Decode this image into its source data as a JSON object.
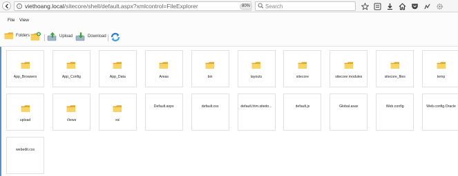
{
  "browser": {
    "url_host": "viethoang.local",
    "url_path": "/sitecore/shell/default.aspx?xmlcontrol=FileExplorer",
    "zoom": "80%",
    "search_placeholder": "Search"
  },
  "menu": {
    "file": "File",
    "view": "View"
  },
  "toolbar": {
    "folders": "Folders",
    "upload": "Upload",
    "download": "Download"
  },
  "items": [
    {
      "name": "App_Browsers",
      "type": "folder"
    },
    {
      "name": "App_Config",
      "type": "folder"
    },
    {
      "name": "App_Data",
      "type": "folder"
    },
    {
      "name": "Areas",
      "type": "folder"
    },
    {
      "name": "bin",
      "type": "folder"
    },
    {
      "name": "layouts",
      "type": "folder"
    },
    {
      "name": "sitecore",
      "type": "folder"
    },
    {
      "name": "sitecore modules",
      "type": "folder"
    },
    {
      "name": "sitecore_files",
      "type": "folder"
    },
    {
      "name": "temp",
      "type": "folder"
    },
    {
      "name": "upload",
      "type": "folder"
    },
    {
      "name": "Views",
      "type": "folder"
    },
    {
      "name": "xsl",
      "type": "folder"
    },
    {
      "name": "Default.aspx",
      "type": "file"
    },
    {
      "name": "default.css",
      "type": "file"
    },
    {
      "name": "default.htm.sitedo...",
      "type": "file"
    },
    {
      "name": "default.js",
      "type": "file"
    },
    {
      "name": "Global.asax",
      "type": "file"
    },
    {
      "name": "Web.config",
      "type": "file"
    },
    {
      "name": "Web.config.Oracle",
      "type": "file"
    },
    {
      "name": "webedit.css",
      "type": "file"
    }
  ]
}
